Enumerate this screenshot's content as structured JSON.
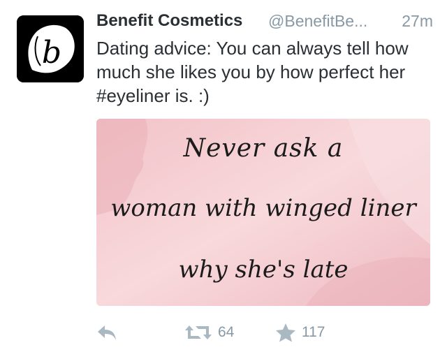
{
  "tweet": {
    "author_name": "Benefit Cosmetics",
    "handle": "@BenefitBe...",
    "time": "27m",
    "text": "Dating advice: You can always tell how much she likes you by how perfect her #eyeliner is. :)",
    "avatar_letter": "b",
    "media": {
      "lines": [
        "Never ask a",
        "woman with winged liner",
        "why she's late"
      ]
    },
    "actions": {
      "retweet_count": "64",
      "favorite_count": "117"
    }
  },
  "colors": {
    "text": "#292f33",
    "muted": "#8899a6",
    "icon": "#aab8c2",
    "media_pink": "#f5cfd3"
  },
  "icons": [
    "reply-icon",
    "retweet-icon",
    "star-icon"
  ]
}
